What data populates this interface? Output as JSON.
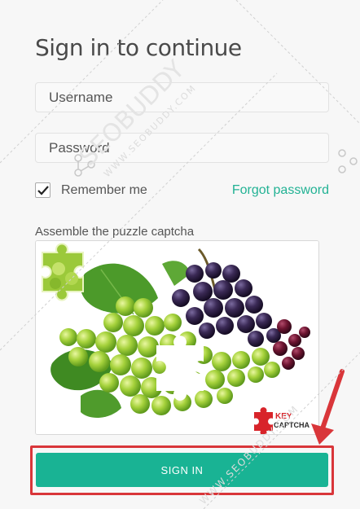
{
  "form": {
    "title": "Sign in to continue",
    "username_placeholder": "Username",
    "password_placeholder": "Password",
    "remember_label": "Remember me",
    "remember_checked": true,
    "forgot_label": "Forgot password",
    "captcha_label": "Assemble the puzzle captcha",
    "signin_label": "SIGN IN"
  },
  "captcha": {
    "logo_top": "KEY",
    "logo_bottom": "CAPTCHA"
  },
  "watermark": {
    "text_large": "SEOBUDDY",
    "text_small": "WWW.SEOBUDDY.COM"
  },
  "colors": {
    "accent": "#19b394",
    "link": "#22b294",
    "highlight": "#d9363a"
  }
}
